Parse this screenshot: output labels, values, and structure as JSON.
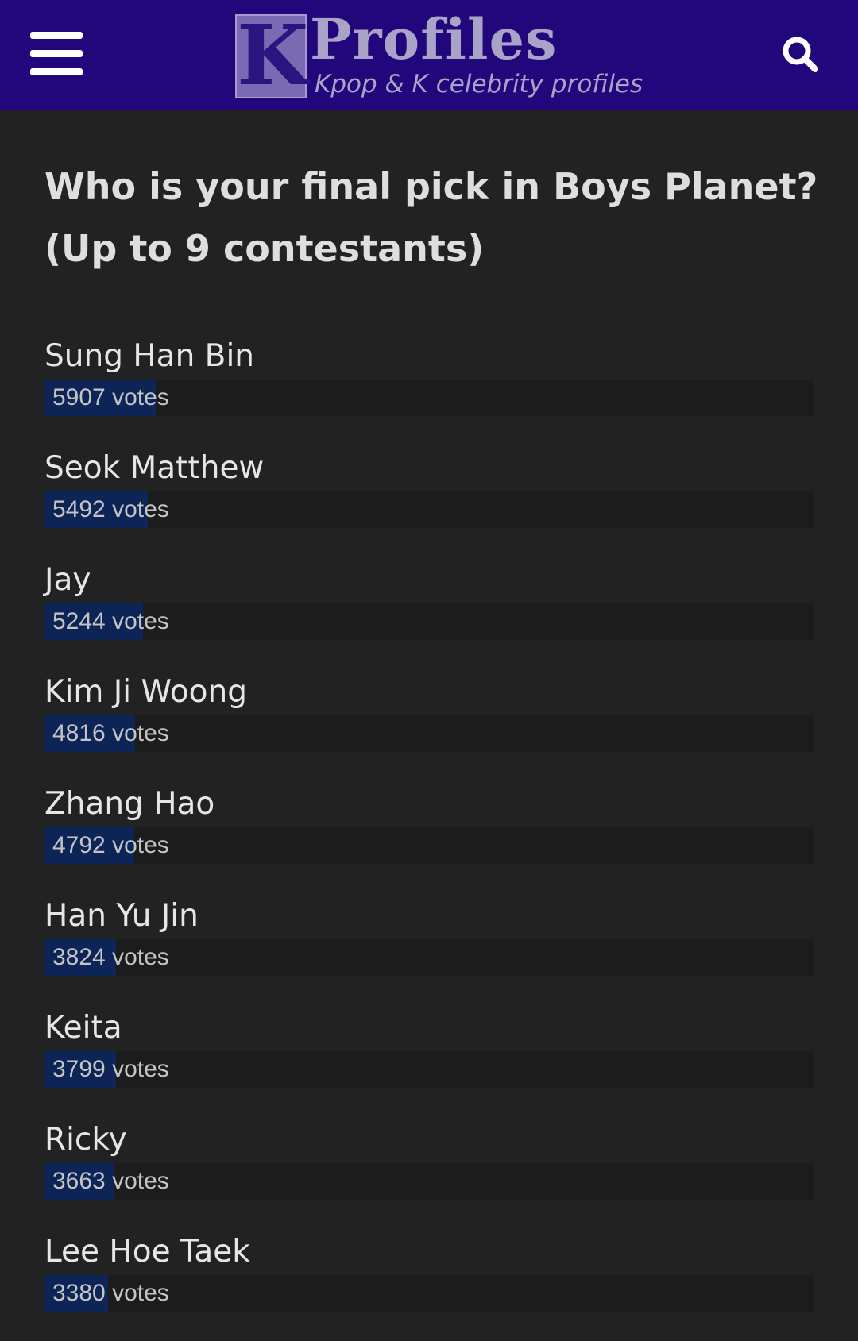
{
  "header": {
    "logo_letter": "K",
    "logo_word": "Profiles",
    "logo_tagline": "Kpop & K celebrity profiles",
    "background_color": "#22077c",
    "menu_icon": "hamburger-menu-icon",
    "search_icon": "search-icon"
  },
  "poll": {
    "title": "Who is your final pick in Boys Planet? (Up to 9 contestants)",
    "bar_color": "#0d2456",
    "options": [
      {
        "name": "Sung Han Bin",
        "votes_text": "5907 votes",
        "votes": 5907
      },
      {
        "name": "Seok Matthew",
        "votes_text": "5492 votes",
        "votes": 5492
      },
      {
        "name": "Jay",
        "votes_text": "5244 votes",
        "votes": 5244
      },
      {
        "name": "Kim Ji Woong",
        "votes_text": "4816 votes",
        "votes": 4816
      },
      {
        "name": "Zhang Hao",
        "votes_text": "4792 votes",
        "votes": 4792
      },
      {
        "name": "Han Yu Jin",
        "votes_text": "3824 votes",
        "votes": 3824
      },
      {
        "name": "Keita",
        "votes_text": "3799 votes",
        "votes": 3799
      },
      {
        "name": "Ricky",
        "votes_text": "3663 votes",
        "votes": 3663
      },
      {
        "name": "Lee Hoe Taek",
        "votes_text": "3380 votes",
        "votes": 3380
      }
    ]
  }
}
